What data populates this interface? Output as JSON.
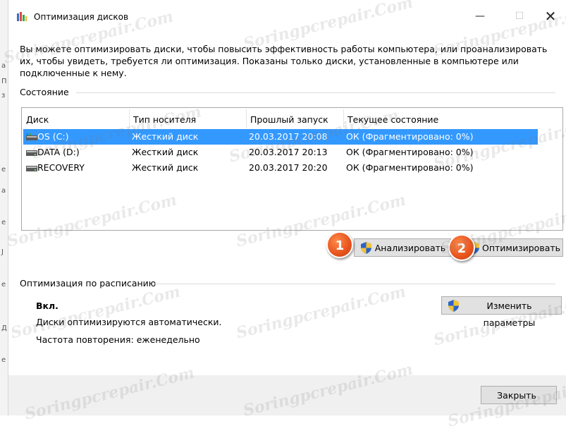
{
  "window": {
    "title": "Оптимизация дисков",
    "minimize": "—",
    "maximize": "☐",
    "close": "✕"
  },
  "description": "Вы можете оптимизировать диски, чтобы повысить эффективность работы  компьютера, или проанализировать их, чтобы увидеть, требуется ли оптимизация. Показаны только диски, установленные в компьютере или подключенные к нему.",
  "status_group": {
    "label": "Состояние"
  },
  "columns": [
    "Диск",
    "Тип носителя",
    "Прошлый запуск",
    "Текущее состояние"
  ],
  "disks": [
    {
      "name": "OS (C:)",
      "type": "Жесткий диск",
      "last_run": "20.03.2017 20:08",
      "status": "ОК (Фрагментировано: 0%)",
      "selected": true,
      "icon": "system-drive-icon"
    },
    {
      "name": "DATA (D:)",
      "type": "Жесткий диск",
      "last_run": "20.03.2017 20:13",
      "status": "ОК (Фрагментировано: 0%)",
      "selected": false,
      "icon": "hard-drive-icon"
    },
    {
      "name": "RECOVERY",
      "type": "Жесткий диск",
      "last_run": "20.03.2017 20:20",
      "status": "ОК (Фрагментировано: 0%)",
      "selected": false,
      "icon": "hard-drive-icon"
    }
  ],
  "buttons": {
    "analyze": "Анализировать",
    "optimize": "Оптимизировать",
    "change_settings": "Изменить параметры",
    "close": "Закрыть"
  },
  "badges": {
    "first": "1",
    "second": "2"
  },
  "schedule": {
    "label": "Оптимизация по расписанию",
    "state": "Вкл.",
    "auto": "Диски оптимизируются автоматически.",
    "frequency": "Частота повторения: еженедельно"
  },
  "watermark": "Soringpcrepair.Com",
  "background_chars": [
    "а",
    "П",
    "з",
    "е",
    "а",
    "е",
    "Ј",
    "е",
    "Д",
    "е"
  ],
  "colors": {
    "selection": "#3399ff",
    "badge": "#e7531d",
    "button": "#e1e1e1"
  }
}
